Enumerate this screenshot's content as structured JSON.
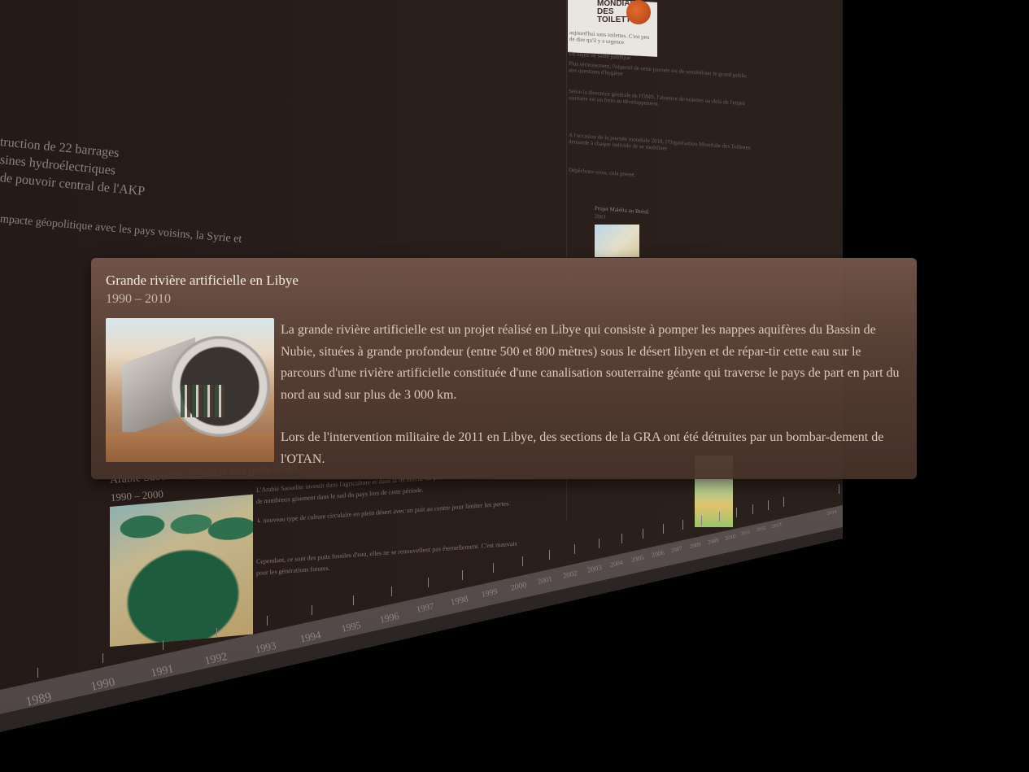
{
  "popup": {
    "title": "Grande rivière artificielle en Libye",
    "dates": "1990 – 2010",
    "paragraph_1": "La grande rivière artificielle est un projet réalisé en Libye qui consiste à pomper les nappes aquifères du Bassin de Nubie, situées à grande profondeur (entre 500 et 800 mètres) sous le désert libyen et de répar-tir cette eau sur le parcours d'une rivière artificielle constituée d'une canalisation souterraine géante qui traverse le pays de part en part du nord au sud sur plus de 3 000 km.",
    "paragraph_2": "Lors de l'intervention militaire de 2011 en Libye, des sections de la GRA ont été détruites par un bombar-dement de l'OTAN."
  },
  "background_card": {
    "lines": [
      "truction de 22 barrages",
      "sines hydroélectriques",
      "de pouvoir central de l'AKP",
      "mpacte géopolitique avec les pays voisins, la Syrie et"
    ]
  },
  "saudi_card": {
    "title": "Arabie Saoudite découvre des puits d'eau",
    "dates": "1990 – 2000",
    "body_1": "L'Arabie Saoudite investit dans l'agriculture et dans la recherche de puit d'eau dans les 90s : elle trouve de nombreux gisement dans le sud du pays lors de cette période.",
    "body_2": "↳ nouveau type de culture circulaire en plein désert avec un puit au centre pour limiter les pertes.",
    "body_3": "Cependant, ce sont des puits fossiles d'eau, elles ne se renouvellent pas éternellement. C'est mauvais pour les générations futures."
  },
  "right_column": {
    "poster_text": "MONDIALE DES TOILETTES",
    "map_title": "Projet Malélia au Brésil",
    "map_year": "2001",
    "texts": [
      "aujourd'hui sans toilettes. C'est peu de dire qu'il y a urgence.",
      "Un enjeu de santé publique",
      "Plus sérieusement, l'objectif de cette journée est de sensibiliser le grand public aux questions d'hygiène",
      "Selon la directrice générale de l'OMS, l'absence de toilettes au-delà de l'enjeu sanitaire est un frein au développement.",
      "A l'occasion de la journée mondiale 2018, l'Organisation Mondiale des Toilettes demande à chaque individu de se mobiliser.",
      "Dépêchons-nous, cela presse."
    ]
  },
  "timeline": {
    "years": [
      "1989",
      "1990",
      "1991",
      "1992",
      "1993",
      "1994",
      "1995",
      "1996",
      "1997",
      "1998",
      "1999",
      "2000",
      "2001",
      "2002",
      "2003",
      "2004",
      "2005",
      "2006",
      "2007",
      "2008",
      "2009",
      "2010",
      "2011",
      "2012",
      "2013",
      "2014"
    ]
  }
}
